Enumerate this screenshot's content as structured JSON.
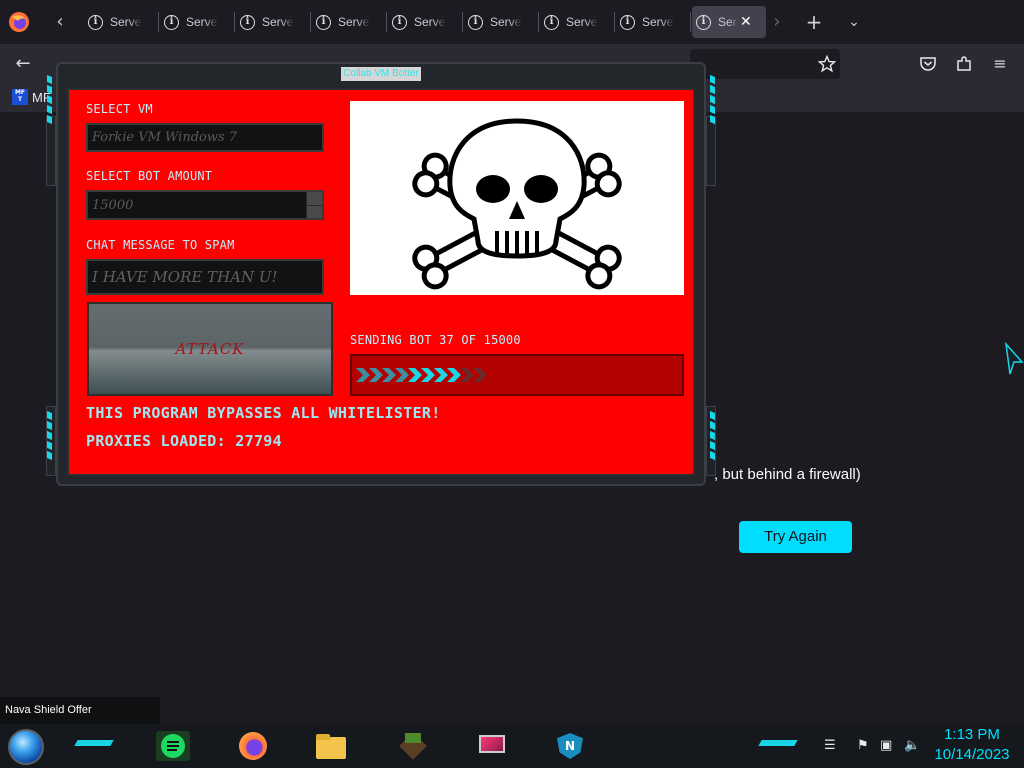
{
  "browser": {
    "tabs": [
      {
        "title": "Server"
      },
      {
        "title": "Server"
      },
      {
        "title": "Server"
      },
      {
        "title": "Server"
      },
      {
        "title": "Server"
      },
      {
        "title": "Server"
      },
      {
        "title": "Server"
      },
      {
        "title": "Server"
      },
      {
        "title": "Ser"
      }
    ],
    "bookmark_label": "MF"
  },
  "page": {
    "message": ", but behind a firewall)",
    "try_again": "Try Again"
  },
  "popup": {
    "title": "Collab VM Botter",
    "select_vm_label": "SELECT VM",
    "select_vm_value": "Forkie VM Windows 7",
    "bot_amount_label": "SELECT BOT AMOUNT",
    "bot_amount_value": "15000",
    "chat_label": "CHAT MESSAGE TO SPAM",
    "chat_value": "I HAVE MORE THAN U!",
    "attack_label": "ATTACK",
    "progress_label": "SENDING BOT 37 OF 15000",
    "bypass_text": "THIS PROGRAM BYPASSES ALL WHITELISTER!",
    "proxies_text": "PROXIES LOADED: 27794"
  },
  "taskbar": {
    "notification": "Nava Shield Offer",
    "time": "1:13 PM",
    "date": "10/14/2023"
  },
  "colors": {
    "panel_red": "#ff0000",
    "accent_cyan": "#19d7e6",
    "button_cyan": "#00ddff"
  }
}
